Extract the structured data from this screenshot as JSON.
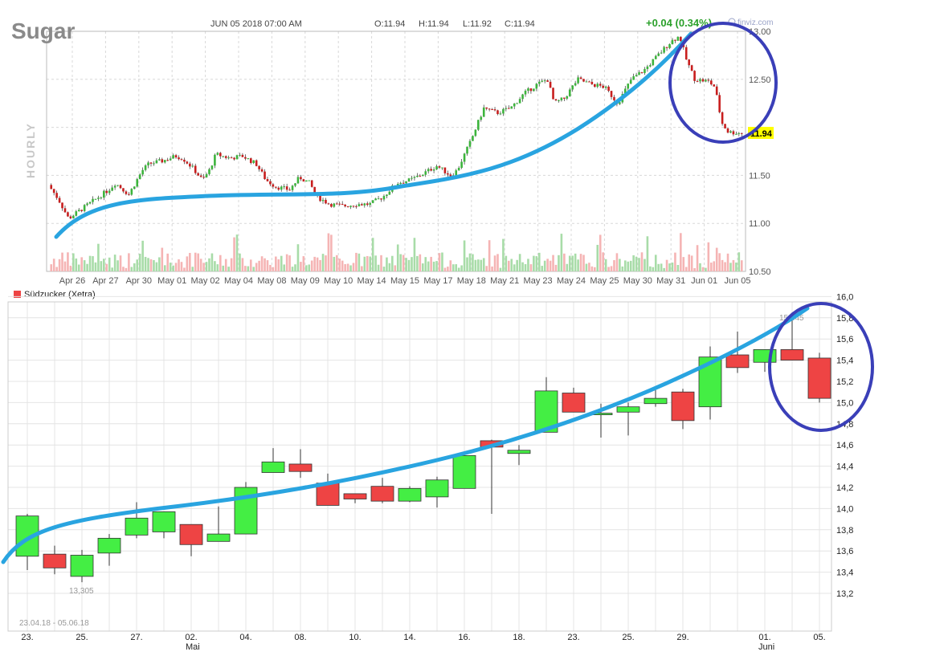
{
  "colors": {
    "up": "#3cb43c",
    "down": "#c81e1e",
    "vol_up": "#a8dca8",
    "vol_down": "#f5b4b4",
    "up2": "#44ee44",
    "down2": "#ee4444",
    "trend": "#29a4e0",
    "circle": "#3a3fb8",
    "highlight": "#ffff00",
    "grid": "#d8d8d8"
  },
  "top": {
    "title": "Sugar",
    "date": "JUN 05 2018 07:00 AM",
    "open": "O:11.94",
    "high": "H:11.94",
    "low": "L:11.92",
    "close": "C:11.94",
    "change": "+0.04 (0.34%)",
    "brand": "finviz.com",
    "side_label": "HOURLY",
    "last_price": "11.94"
  },
  "bottom": {
    "legend": "Südzucker (Xetra)",
    "range": "23.04.18 - 05.06.18",
    "low_label": "13,305",
    "high_label": "15,845",
    "month_mai": "Mai",
    "month_juni": "Juni"
  },
  "chart_data": [
    {
      "type": "candlestick",
      "title": "Sugar",
      "interval": "hourly",
      "ylim": [
        10.5,
        13.0
      ],
      "y_ticks": [
        "13.00",
        "12.50",
        "12.00",
        "11.50",
        "11.00",
        "10.50"
      ],
      "x_tick_labels": [
        "Apr 26",
        "Apr 27",
        "Apr 30",
        "May 01",
        "May 02",
        "May 04",
        "May 08",
        "May 09",
        "May 10",
        "May 14",
        "May 15",
        "May 17",
        "May 18",
        "May 21",
        "May 23",
        "May 24",
        "May 25",
        "May 30",
        "May 31",
        "Jun 01",
        "Jun 05"
      ],
      "price_path": [
        [
          0,
          11.4
        ],
        [
          0.3,
          11.25
        ],
        [
          0.6,
          11.05
        ],
        [
          1.0,
          11.15
        ],
        [
          1.4,
          11.25
        ],
        [
          1.8,
          11.35
        ],
        [
          2.0,
          11.42
        ],
        [
          2.4,
          11.3
        ],
        [
          2.8,
          11.55
        ],
        [
          3.0,
          11.62
        ],
        [
          3.4,
          11.65
        ],
        [
          3.8,
          11.7
        ],
        [
          4.0,
          11.68
        ],
        [
          4.3,
          11.58
        ],
        [
          4.6,
          11.45
        ],
        [
          4.8,
          11.55
        ],
        [
          5.0,
          11.72
        ],
        [
          5.4,
          11.68
        ],
        [
          5.8,
          11.7
        ],
        [
          6.2,
          11.62
        ],
        [
          6.5,
          11.45
        ],
        [
          6.8,
          11.38
        ],
        [
          7.2,
          11.35
        ],
        [
          7.5,
          11.48
        ],
        [
          7.8,
          11.42
        ],
        [
          8.0,
          11.28
        ],
        [
          8.4,
          11.2
        ],
        [
          8.8,
          11.18
        ],
        [
          9.2,
          11.2
        ],
        [
          9.6,
          11.2
        ],
        [
          10.0,
          11.28
        ],
        [
          10.4,
          11.42
        ],
        [
          10.8,
          11.45
        ],
        [
          11.2,
          11.52
        ],
        [
          11.6,
          11.6
        ],
        [
          12.0,
          11.5
        ],
        [
          12.2,
          11.55
        ],
        [
          12.6,
          11.85
        ],
        [
          13.0,
          12.2
        ],
        [
          13.4,
          12.15
        ],
        [
          13.8,
          12.2
        ],
        [
          14.2,
          12.35
        ],
        [
          14.6,
          12.45
        ],
        [
          14.9,
          12.5
        ],
        [
          15.1,
          12.25
        ],
        [
          15.4,
          12.3
        ],
        [
          15.8,
          12.5
        ],
        [
          16.2,
          12.45
        ],
        [
          16.6,
          12.42
        ],
        [
          17.0,
          12.25
        ],
        [
          17.4,
          12.5
        ],
        [
          17.8,
          12.6
        ],
        [
          18.2,
          12.75
        ],
        [
          18.6,
          12.9
        ],
        [
          18.85,
          12.95
        ],
        [
          19.05,
          12.7
        ],
        [
          19.3,
          12.5
        ],
        [
          19.7,
          12.48
        ],
        [
          19.9,
          12.42
        ],
        [
          20.1,
          12.05
        ],
        [
          20.3,
          11.95
        ],
        [
          20.7,
          11.94
        ]
      ],
      "volume_note": "bars shaded green (up) / pink (down) at the bottom",
      "trend_line": "hand-drawn curve, rising",
      "annotation": "hand-drawn circle around the final drop"
    },
    {
      "type": "candlestick",
      "title": "Südzucker (Xetra)",
      "ylim": [
        13.0,
        16.0
      ],
      "y_ticks": [
        "16,0",
        "15,8",
        "15,6",
        "15,4",
        "15,2",
        "15,0",
        "14,8",
        "14,6",
        "14,4",
        "14,2",
        "14,0",
        "13,8",
        "13,6",
        "13,4",
        "13,2"
      ],
      "x_tick_labels": [
        "23.",
        "25.",
        "27.",
        "02.",
        "04.",
        "08.",
        "10.",
        "14.",
        "16.",
        "18.",
        "23.",
        "25.",
        "29.",
        "01.",
        "05."
      ],
      "candles": [
        {
          "o": 13.55,
          "h": 13.95,
          "l": 13.42,
          "c": 13.93
        },
        {
          "o": 13.57,
          "h": 13.65,
          "l": 13.38,
          "c": 13.44
        },
        {
          "o": 13.36,
          "h": 13.61,
          "l": 13.305,
          "c": 13.56
        },
        {
          "o": 13.58,
          "h": 13.76,
          "l": 13.46,
          "c": 13.72
        },
        {
          "o": 13.75,
          "h": 14.06,
          "l": 13.72,
          "c": 13.91
        },
        {
          "o": 13.78,
          "h": 13.96,
          "l": 13.72,
          "c": 13.97
        },
        {
          "o": 13.85,
          "h": 13.85,
          "l": 13.55,
          "c": 13.66
        },
        {
          "o": 13.69,
          "h": 14.02,
          "l": 13.69,
          "c": 13.76
        },
        {
          "o": 13.76,
          "h": 14.25,
          "l": 13.76,
          "c": 14.2
        },
        {
          "o": 14.34,
          "h": 14.57,
          "l": 14.34,
          "c": 14.44
        },
        {
          "o": 14.42,
          "h": 14.56,
          "l": 14.29,
          "c": 14.35
        },
        {
          "o": 14.24,
          "h": 14.33,
          "l": 14.03,
          "c": 14.03
        },
        {
          "o": 14.14,
          "h": 14.14,
          "l": 14.05,
          "c": 14.09
        },
        {
          "o": 14.21,
          "h": 14.29,
          "l": 14.05,
          "c": 14.07
        },
        {
          "o": 14.07,
          "h": 14.21,
          "l": 14.06,
          "c": 14.19
        },
        {
          "o": 14.11,
          "h": 14.3,
          "l": 14.01,
          "c": 14.27
        },
        {
          "o": 14.19,
          "h": 14.52,
          "l": 14.19,
          "c": 14.5
        },
        {
          "o": 14.64,
          "h": 14.65,
          "l": 13.95,
          "c": 14.58
        },
        {
          "o": 14.52,
          "h": 14.6,
          "l": 14.41,
          "c": 14.55
        },
        {
          "o": 14.72,
          "h": 15.24,
          "l": 14.72,
          "c": 15.11
        },
        {
          "o": 15.09,
          "h": 15.14,
          "l": 14.91,
          "c": 14.91
        },
        {
          "o": 14.89,
          "h": 14.99,
          "l": 14.67,
          "c": 14.9
        },
        {
          "o": 14.91,
          "h": 15.0,
          "l": 14.69,
          "c": 14.96
        },
        {
          "o": 14.99,
          "h": 15.14,
          "l": 14.96,
          "c": 15.04
        },
        {
          "o": 15.1,
          "h": 15.13,
          "l": 14.75,
          "c": 14.83
        },
        {
          "o": 14.96,
          "h": 15.53,
          "l": 14.84,
          "c": 15.43
        },
        {
          "o": 15.45,
          "h": 15.67,
          "l": 15.28,
          "c": 15.33
        },
        {
          "o": 15.38,
          "h": 15.5,
          "l": 15.29,
          "c": 15.5
        },
        {
          "o": 15.5,
          "h": 15.845,
          "l": 15.4,
          "c": 15.4
        },
        {
          "o": 15.42,
          "h": 15.47,
          "l": 15.0,
          "c": 15.04
        }
      ],
      "trend_line": "hand-drawn curve, rising",
      "annotation": "hand-drawn circle around the last three candles"
    }
  ]
}
